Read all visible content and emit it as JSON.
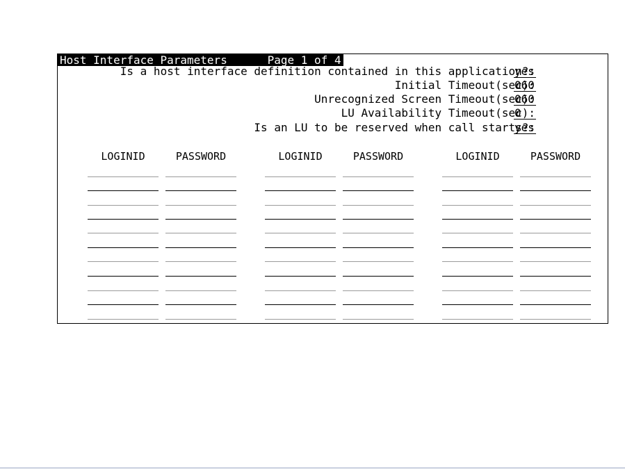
{
  "form": {
    "title": "Host Interface Parameters",
    "page_label": "Page 1 of 4",
    "fields": [
      {
        "label": "Is a host interface definition contained in this application?:",
        "value": "yes"
      },
      {
        "label": "Initial Timeout(sec):",
        "value": "060"
      },
      {
        "label": "Unrecognized Screen Timeout(sec):",
        "value": "060"
      },
      {
        "label": "LU Availability Timeout(sec):",
        "value": "0"
      },
      {
        "label": "Is an LU to be reserved when call starts?:",
        "value": "yes"
      }
    ],
    "columns": [
      {
        "loginid_label": "LOGINID",
        "password_label": "PASSWORD"
      },
      {
        "loginid_label": "LOGINID",
        "password_label": "PASSWORD"
      },
      {
        "loginid_label": "LOGINID",
        "password_label": "PASSWORD"
      }
    ],
    "rows_per_column": 11
  }
}
